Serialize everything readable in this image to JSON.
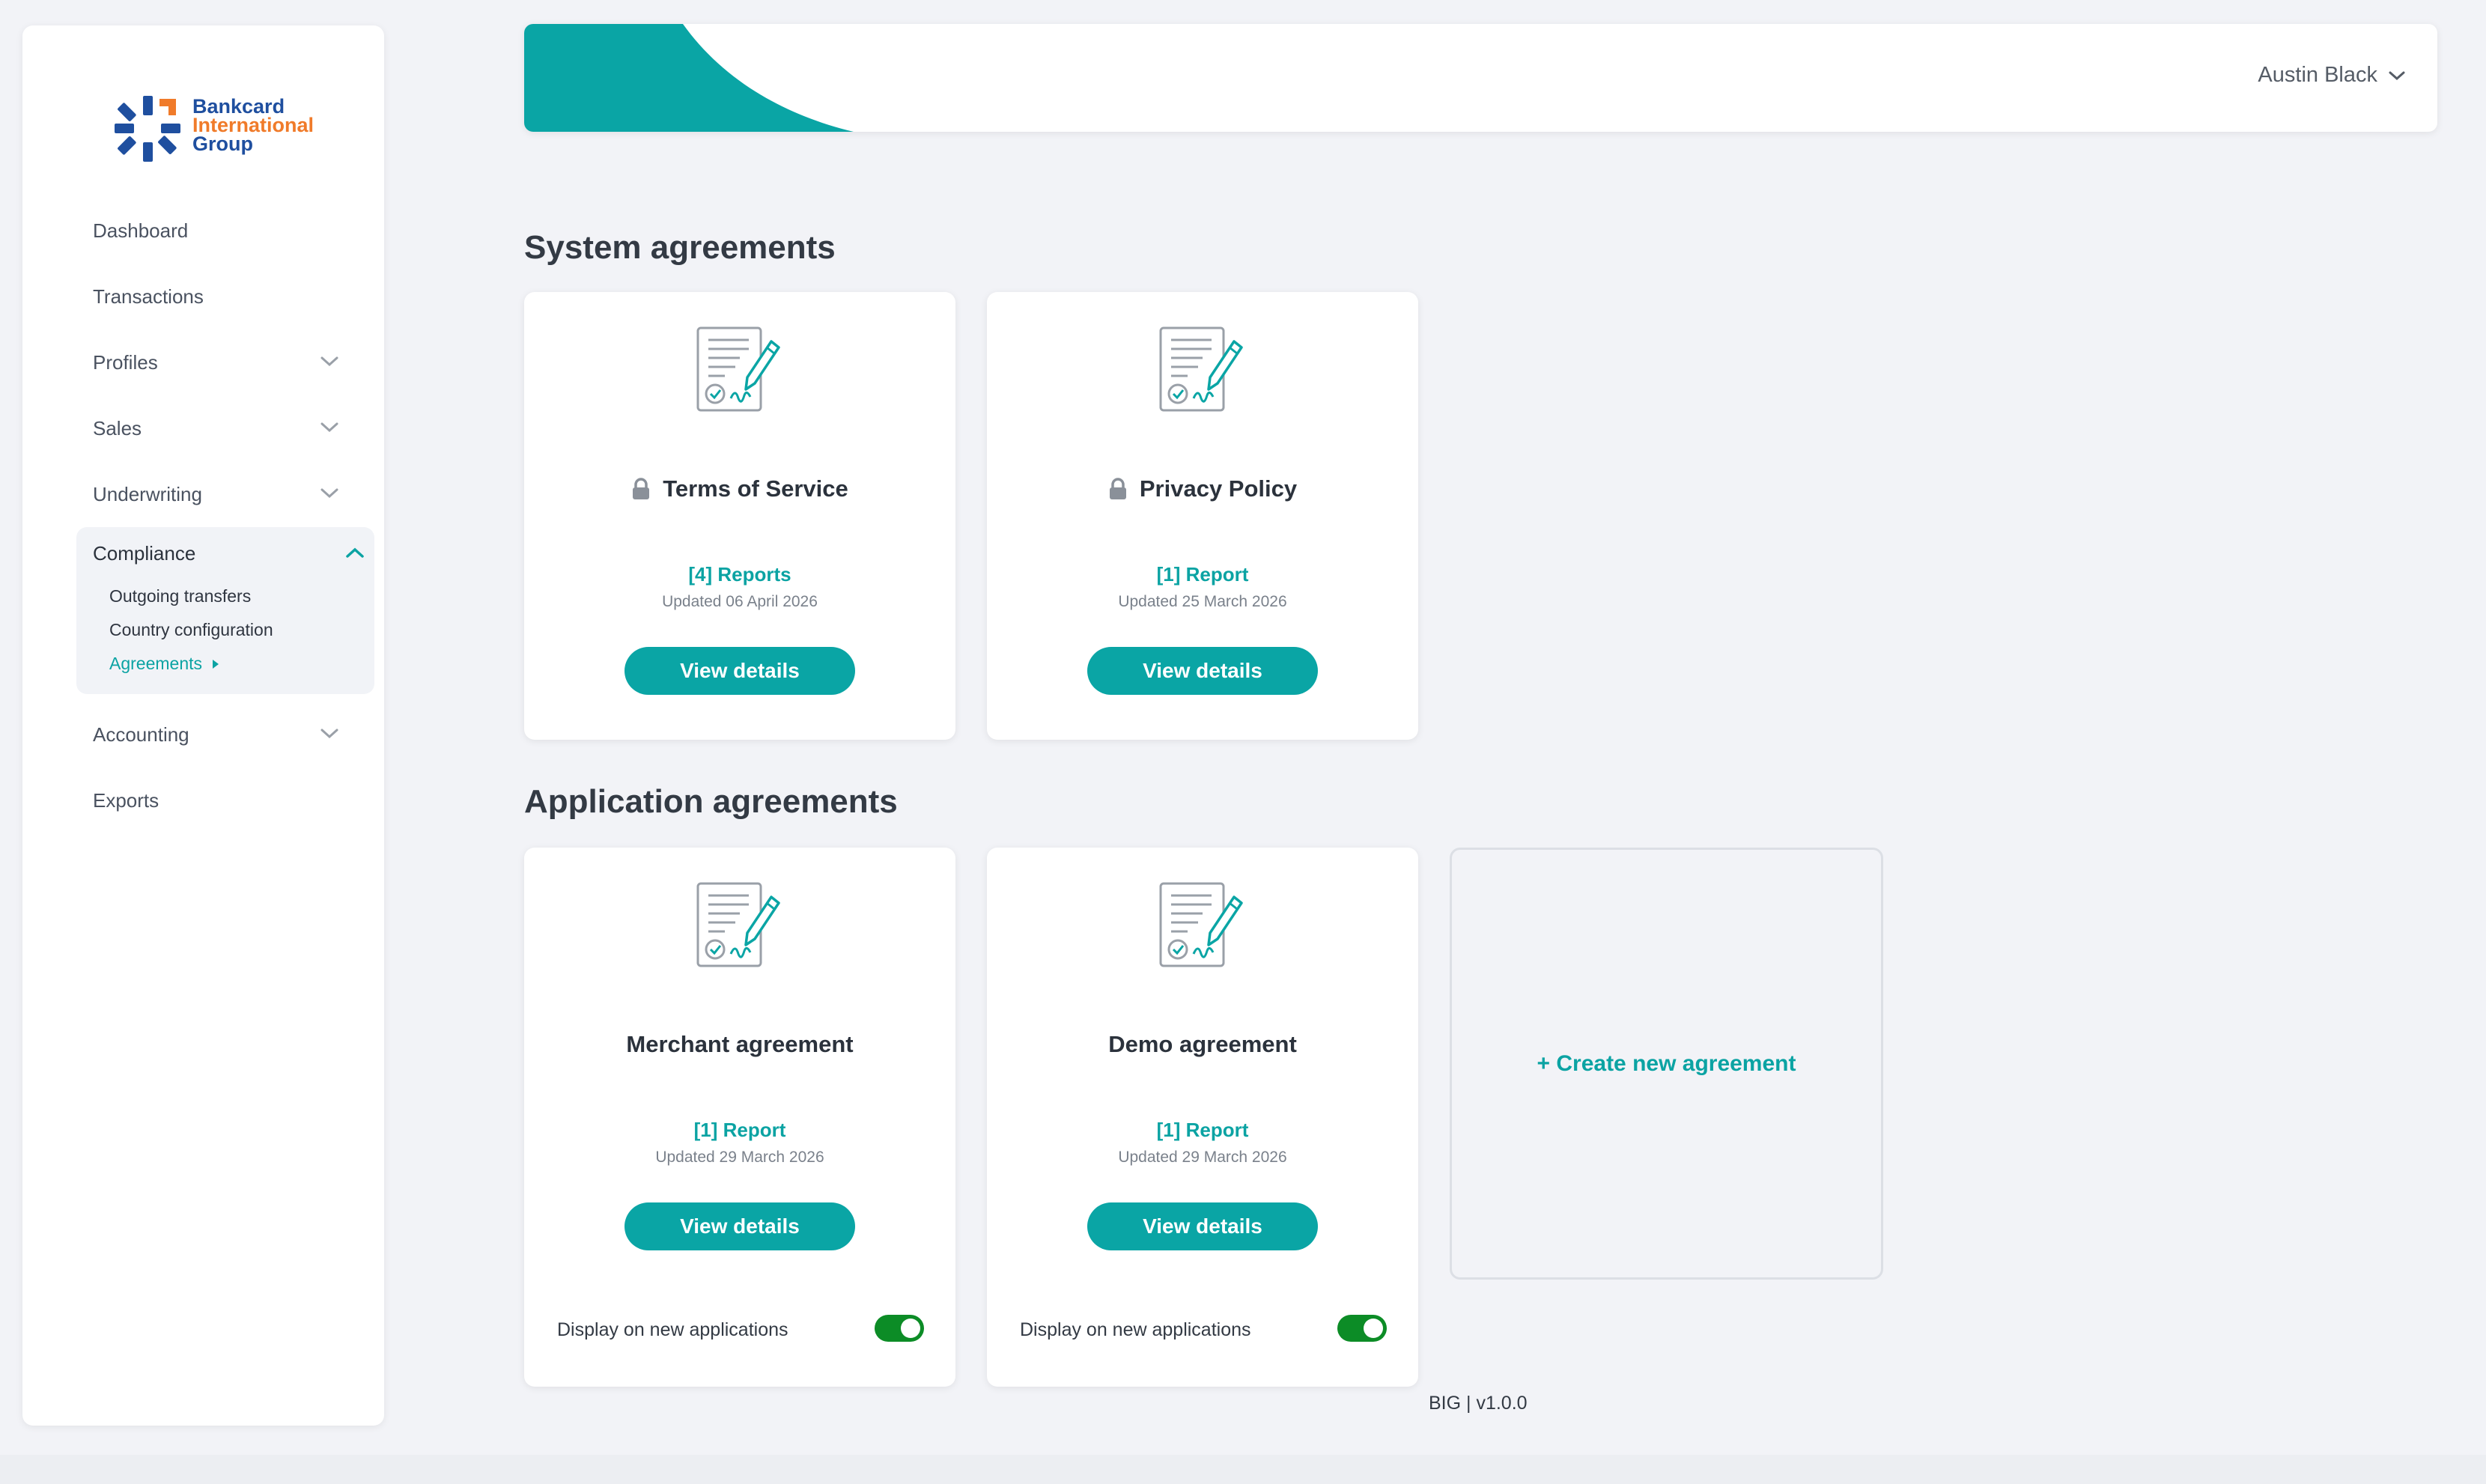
{
  "brand": {
    "line1": "Bankcard",
    "line2": "International",
    "line3": "Group",
    "accent_color": "#0aa5a5",
    "brand_blue": "#1f4f9f",
    "brand_orange": "#f07b2a"
  },
  "sidebar": {
    "items": [
      {
        "label": "Dashboard"
      },
      {
        "label": "Transactions"
      },
      {
        "label": "Profiles"
      },
      {
        "label": "Sales"
      },
      {
        "label": "Underwriting"
      },
      {
        "label": "Compliance",
        "expanded": true
      },
      {
        "label": "Accounting"
      },
      {
        "label": "Exports"
      }
    ],
    "compliance_subitems": [
      {
        "label": "Outgoing transfers"
      },
      {
        "label": "Country configuration"
      },
      {
        "label": "Agreements",
        "active": true
      }
    ]
  },
  "header": {
    "user_name": "Austin Black"
  },
  "system_section": {
    "title": "System agreements",
    "cards": [
      {
        "title": "Terms of Service",
        "locked": true,
        "reports": "[4] Reports",
        "updated": "Updated 06 April 2026",
        "button": "View details"
      },
      {
        "title": "Privacy Policy",
        "locked": true,
        "reports": "[1] Report",
        "updated": "Updated 25 March 2026",
        "button": "View details"
      }
    ]
  },
  "application_section": {
    "title": "Application agreements",
    "cards": [
      {
        "title": "Merchant agreement",
        "reports": "[1] Report",
        "updated": "Updated 29 March 2026",
        "button": "View details",
        "display_label": "Display on new applications",
        "display_enabled": true
      },
      {
        "title": "Demo agreement",
        "reports": "[1] Report",
        "updated": "Updated 29 March 2026",
        "button": "View details",
        "display_label": "Display on new applications",
        "display_enabled": true
      }
    ],
    "create_label": "+  Create new agreement"
  },
  "footer": {
    "version": "BIG | v1.0.0"
  }
}
